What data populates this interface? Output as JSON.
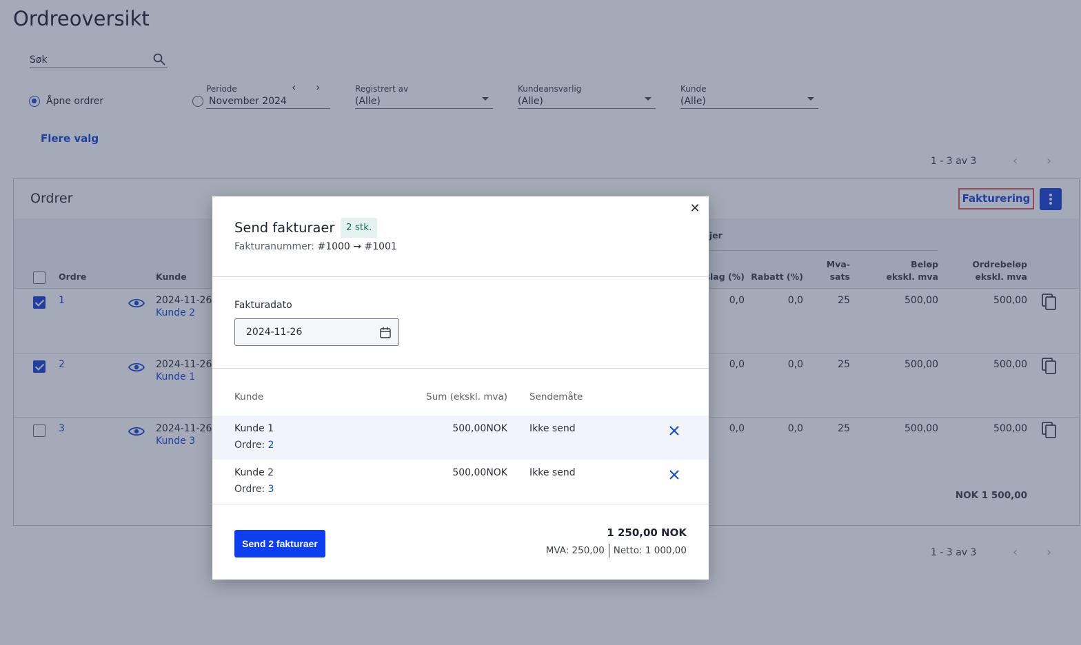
{
  "page": {
    "title": "Ordreoversikt",
    "search_label": "Søk"
  },
  "filters": {
    "open_orders_label": "Åpne ordrer",
    "period_label": "Periode",
    "period_value": "November 2024",
    "registered_by_label": "Registrert av",
    "registered_by_value": "(Alle)",
    "account_manager_label": "Kundeansvarlig",
    "account_manager_value": "(Alle)",
    "customer_label": "Kunde",
    "customer_value": "(Alle)",
    "more_options": "Flere valg"
  },
  "pagination": {
    "label": "1 - 3 av 3"
  },
  "orders": {
    "title": "Ordrer",
    "billing_button": "Fakturering",
    "group_header": "njer",
    "columns": {
      "order": "Ordre",
      "customer": "Kunde",
      "markup": "slag (%)",
      "discount": "Rabatt (%)",
      "vat_line1": "Mva-",
      "vat_line2": "sats",
      "amount_line1": "Beløp",
      "amount_line2": "ekskl. mva",
      "order_amount_line1": "Ordrebeløp",
      "order_amount_line2": "ekskl. mva"
    },
    "rows": [
      {
        "id": "1",
        "date": "2024-11-26",
        "customer": "Kunde 2",
        "markup": "0,0",
        "discount": "0,0",
        "vat": "25",
        "amount": "500,00",
        "order_amount": "500,00",
        "checked": true
      },
      {
        "id": "2",
        "date": "2024-11-26",
        "customer": "Kunde 1",
        "markup": "0,0",
        "discount": "0,0",
        "vat": "25",
        "amount": "500,00",
        "order_amount": "500,00",
        "checked": true
      },
      {
        "id": "3",
        "date": "2024-11-26",
        "customer": "Kunde 3",
        "markup": "0,0",
        "discount": "0,0",
        "vat": "25",
        "amount": "500,00",
        "order_amount": "500,00",
        "checked": false
      }
    ],
    "total": "NOK 1 500,00"
  },
  "modal": {
    "title": "Send fakturaer",
    "badge": "2 stk.",
    "invoice_number_label": "Fakturanummer:",
    "invoice_number_range": "#1000 → #1001",
    "date_label": "Fakturadato",
    "date_value": "2024-11-26",
    "columns": {
      "customer": "Kunde",
      "sum": "Sum (ekskl. mva)",
      "method": "Sendemåte"
    },
    "rows": [
      {
        "customer": "Kunde 1",
        "order_label": "Ordre:",
        "order_no": "2",
        "sum": "500,00NOK",
        "method": "Ikke send"
      },
      {
        "customer": "Kunde 2",
        "order_label": "Ordre:",
        "order_no": "3",
        "sum": "500,00NOK",
        "method": "Ikke send"
      }
    ],
    "send_button": "Send 2 fakturaer",
    "total": "1 250,00 NOK",
    "vat": "MVA: 250,00",
    "net": "Netto: 1 000,00"
  },
  "colors": {
    "accent": "#1a47d6",
    "primary_button": "#0d3ff0",
    "badge_bg": "#e3f2ef",
    "highlight_border": "#e35b5b"
  },
  "icons": {
    "search": "search-icon",
    "view": "eye-icon",
    "copy": "copy-icon",
    "calendar": "calendar-icon",
    "remove": "close-icon",
    "menu": "kebab-menu-icon"
  }
}
